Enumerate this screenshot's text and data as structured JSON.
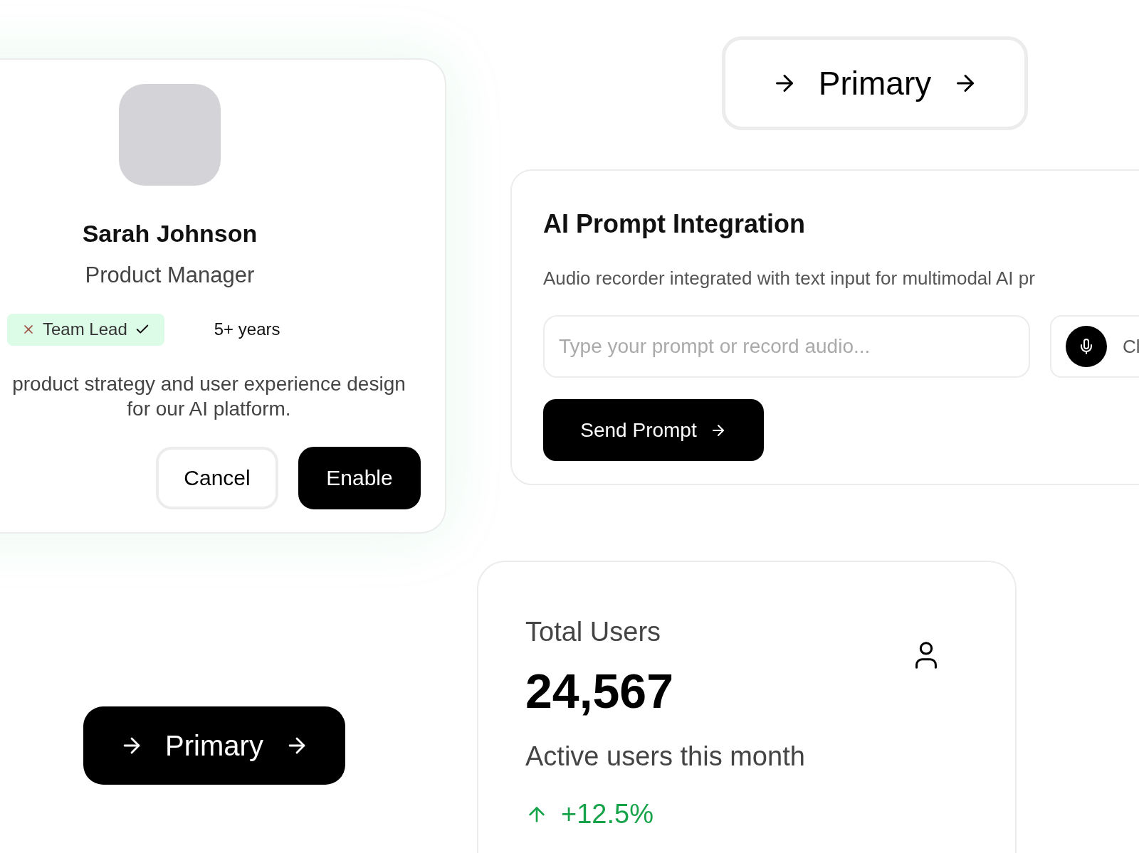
{
  "profile_card": {
    "name": "Sarah Johnson",
    "role": "Product Manager",
    "tag": {
      "label": "Team Lead"
    },
    "experience": "5+ years",
    "description": "product strategy and user experience design for our AI platform.",
    "buttons": [
      {
        "label": "Cancel",
        "kind": "outline"
      },
      {
        "label": "Enable",
        "kind": "solid"
      }
    ]
  },
  "primary_outline_button": {
    "label": "Primary"
  },
  "prompt_card": {
    "title": "AI Prompt Integration",
    "description": "Audio recorder integrated with text input for multimodal AI pr",
    "input": {
      "placeholder": "Type your prompt or record audio..."
    },
    "record_button": {
      "label": "Cl"
    },
    "send_button": {
      "label": "Send Prompt"
    }
  },
  "primary_solid_button": {
    "label": "Primary"
  },
  "stats_card": {
    "title": "Total Users",
    "value": "24,567",
    "caption": "Active users this month",
    "change": "+12.5%"
  }
}
